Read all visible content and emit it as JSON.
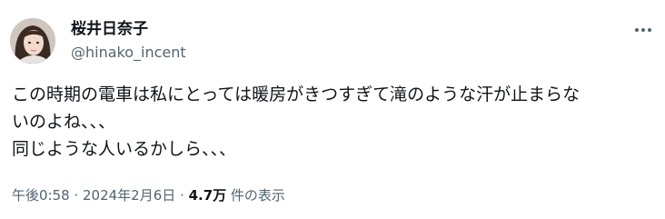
{
  "author": {
    "display_name": "桜井日奈子",
    "handle": "@hinako_incent",
    "avatar_icon": "profile-photo"
  },
  "header": {
    "more_icon": "more-options-icon"
  },
  "tweet": {
    "text_lines": [
      "この時期の電車は私にとっては暖房がきつすぎて滝のような汗が止まらな",
      "いのよね、、、",
      "同じような人いるかしら、、、"
    ]
  },
  "meta": {
    "time": "午後0:58",
    "separator": " · ",
    "date": "2024年2月6日",
    "separator2": " · ",
    "views_count": "4.7万",
    "views_label": " 件の表示"
  },
  "colors": {
    "text": "#0f1419",
    "secondary": "#536471",
    "background": "#ffffff"
  }
}
